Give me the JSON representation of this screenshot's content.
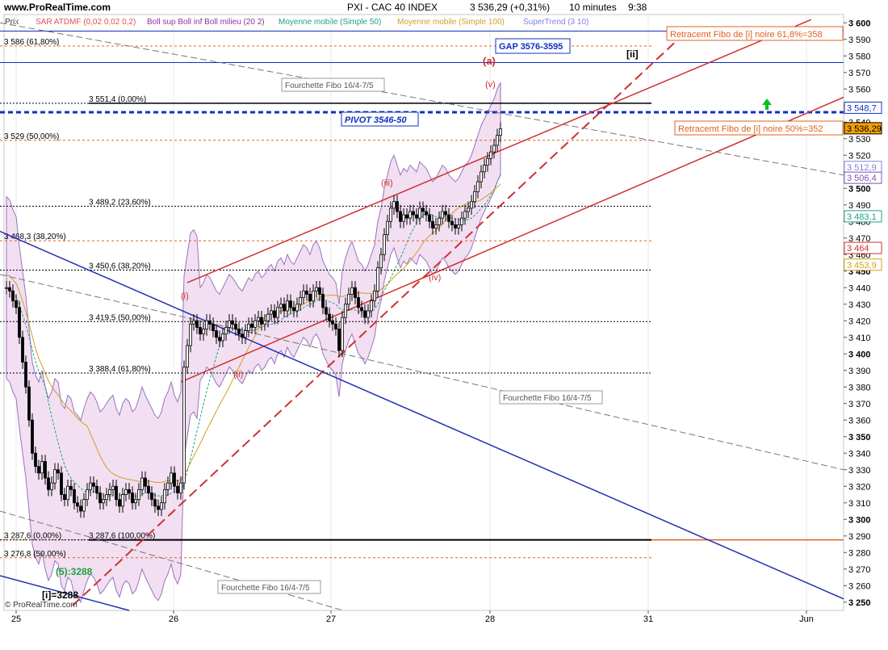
{
  "header": {
    "site": "www.ProRealTime.com",
    "title": "PXI - CAC 40 INDEX",
    "last": "3 536,29 (+0,31%)",
    "timeframe": "10 minutes",
    "time": "9:38",
    "price_label": "Prix",
    "copyright": "© ProRealTime.com"
  },
  "legend": [
    {
      "label": "SAR ATDMF (0,02 0,02 0,2)",
      "color": "#e05050"
    },
    {
      "label": "Boll sup Boll inf Boll milieu (20 2)",
      "color": "#9030a0"
    },
    {
      "label": "Moyenne mobile (Simple 50)",
      "color": "#20a080"
    },
    {
      "label": "Moyenne mobile (Simple 100)",
      "color": "#d0a020"
    },
    {
      "label": "SuperTrend (3 10)",
      "color": "#8080e0"
    }
  ],
  "colors": {
    "up_candle": "#ffffff",
    "down_candle": "#000000",
    "red_line": "#d03030",
    "blue_line": "#2030b0",
    "fibo_orange": "#e06020",
    "pivot_blue": "#1030c0",
    "boll_fill": "#f0d8f0",
    "boll_line": "#8050b0"
  },
  "chart_data": {
    "type": "candlestick",
    "ylim": [
      3245,
      3605
    ],
    "y_ticks": [
      "3 600",
      "3 590",
      "3 580",
      "3 570",
      "3 560",
      "3 550",
      "3 540",
      "3 530",
      "3 520",
      "3 510",
      "3 500",
      "3 490",
      "3 480",
      "3 470",
      "3 460",
      "3 450",
      "3 440",
      "3 430",
      "3 420",
      "3 410",
      "3 400",
      "3 390",
      "3 380",
      "3 370",
      "3 360",
      "3 350",
      "3 340",
      "3 330",
      "3 320",
      "3 310",
      "3 300",
      "3 290",
      "3 280",
      "3 270",
      "3 260",
      "3 250"
    ],
    "x_ticks": [
      "25",
      "26",
      "27",
      "28",
      "31",
      "Jun"
    ],
    "fibo_levels": [
      {
        "label": "3 586 (61,80%)",
        "value": 3586,
        "color": "#e06020"
      },
      {
        "label": "3 551,4 (0,00%)",
        "value": 3551.4,
        "color": "#000000"
      },
      {
        "label": "3 529 (50,00%)",
        "value": 3529,
        "color": "#e06020"
      },
      {
        "label": "3 489,2 (23,60%)",
        "value": 3489.2,
        "color": "#000000"
      },
      {
        "label": "3 468,3 (38,20%)",
        "value": 3468.3,
        "color": "#e06020"
      },
      {
        "label": "3 450,6 (38,20%)",
        "value": 3450.6,
        "color": "#000000"
      },
      {
        "label": "3 419,5 (50,00%)",
        "value": 3419.5,
        "color": "#000000"
      },
      {
        "label": "3 388,4 (61,80%)",
        "value": 3388.4,
        "color": "#000000"
      },
      {
        "label": "3 287,6 (0,00%)",
        "value": 3287.6,
        "color": "#e06020"
      },
      {
        "label": "3 287,6 (100,00%)",
        "value": 3287.6,
        "color": "#000000"
      },
      {
        "label": "3 276,8 (50,00%)",
        "value": 3276.8,
        "color": "#e06020"
      }
    ],
    "price_tags": [
      {
        "label": "3 548,7",
        "value": 3548.7,
        "bg": "#ffffff",
        "color": "#1030c0"
      },
      {
        "label": "3 536,29",
        "value": 3536.29,
        "bg": "#f5a000",
        "color": "#000000"
      },
      {
        "label": "3 512,9",
        "value": 3512.9,
        "bg": "#ffffff",
        "color": "#8080e0"
      },
      {
        "label": "3 506,4",
        "value": 3506.4,
        "bg": "#ffffff",
        "color": "#8050b0"
      },
      {
        "label": "3 483,1",
        "value": 3483.1,
        "bg": "#ffffff",
        "color": "#20a080"
      },
      {
        "label": "3 464",
        "value": 3464,
        "bg": "#ffffff",
        "color": "#d03030"
      },
      {
        "label": "3 453,9",
        "value": 3453.9,
        "bg": "#ffffff",
        "color": "#d0a020"
      }
    ],
    "annotations": {
      "gap": "GAP 3576-3595",
      "pivot": "PIVOT 3546-50",
      "retrace_618": "Retracemt Fibo de [i] noire 61,8%=358",
      "retrace_50": "Retracemt Fibo de [i] noire 50%=352",
      "fourchette": "Fourchette Fibo 16/4-7/5",
      "wave_a": "(a)",
      "wave_ii": "[ii]",
      "wave_v": "(v)",
      "wave_iii": "(iii)",
      "wave_iv": "(iv)",
      "wave_i": "(i)",
      "wave_ii_small": "(ii)",
      "wave_5": "(5):3288",
      "wave_i_bracket": "[i]=3288"
    },
    "series": [
      {
        "name": "PXI - CAC 40 INDEX",
        "x": [
          0,
          4,
          8,
          12,
          16,
          20,
          24,
          28,
          32,
          36,
          40,
          44,
          48,
          52,
          56,
          60,
          64,
          68,
          72,
          76,
          80,
          84,
          88,
          92,
          96,
          100,
          104,
          108,
          112,
          116,
          120,
          124,
          128,
          132,
          136,
          140,
          144,
          148,
          152,
          156,
          160,
          164,
          168,
          172,
          176,
          180,
          184,
          188,
          192,
          196,
          200,
          204,
          208,
          212,
          216,
          220,
          224,
          228,
          232,
          236,
          240,
          244,
          248,
          252,
          256,
          260,
          264,
          268,
          272,
          276,
          280,
          284,
          288,
          292,
          296,
          300,
          304,
          308,
          312,
          316,
          320,
          324,
          328,
          332,
          336,
          340,
          344,
          348,
          352,
          356,
          360,
          364,
          368,
          372,
          376,
          380,
          384,
          388,
          392,
          396,
          400,
          404,
          408,
          412,
          416,
          420,
          424,
          428,
          432,
          436,
          440,
          444,
          448,
          452,
          456,
          460,
          464,
          468,
          472,
          476,
          480,
          484,
          488,
          492,
          496,
          500,
          504,
          508,
          512,
          516,
          520,
          524,
          528,
          532,
          536,
          540,
          544,
          548,
          552,
          556,
          560,
          564,
          568,
          572,
          576,
          580,
          584,
          588,
          592,
          596,
          600,
          604,
          608,
          612
        ],
        "close": [
          3440,
          3438,
          3432,
          3428,
          3410,
          3395,
          3380,
          3360,
          3340,
          3332,
          3328,
          3335,
          3325,
          3318,
          3322,
          3330,
          3328,
          3315,
          3312,
          3320,
          3318,
          3310,
          3308,
          3305,
          3312,
          3318,
          3322,
          3320,
          3316,
          3310,
          3312,
          3315,
          3318,
          3320,
          3312,
          3308,
          3315,
          3318,
          3316,
          3310,
          3312,
          3318,
          3325,
          3320,
          3316,
          3312,
          3308,
          3306,
          3310,
          3318,
          3322,
          3328,
          3320,
          3316,
          3322,
          3392,
          3405,
          3418,
          3420,
          3416,
          3412,
          3415,
          3420,
          3418,
          3414,
          3410,
          3408,
          3412,
          3416,
          3420,
          3418,
          3415,
          3412,
          3410,
          3414,
          3418,
          3416,
          3420,
          3422,
          3418,
          3420,
          3424,
          3426,
          3422,
          3428,
          3430,
          3426,
          3432,
          3428,
          3426,
          3430,
          3434,
          3438,
          3436,
          3432,
          3438,
          3440,
          3436,
          3428,
          3424,
          3420,
          3418,
          3415,
          3402,
          3422,
          3430,
          3436,
          3440,
          3434,
          3428,
          3426,
          3422,
          3426,
          3432,
          3438,
          3452,
          3460,
          3472,
          3480,
          3488,
          3492,
          3486,
          3480,
          3484,
          3482,
          3486,
          3484,
          3482,
          3488,
          3486,
          3484,
          3480,
          3476,
          3478,
          3482,
          3486,
          3484,
          3480,
          3478,
          3476,
          3478,
          3482,
          3486,
          3488,
          3492,
          3498,
          3504,
          3510,
          3514,
          3518,
          3522,
          3526,
          3532,
          3536
        ]
      }
    ]
  }
}
